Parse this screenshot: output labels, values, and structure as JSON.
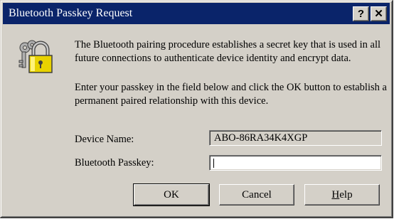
{
  "window": {
    "title": "Bluetooth Passkey Request",
    "help_glyph": "?",
    "close_glyph": "✕"
  },
  "icon": {
    "name": "padlock-keys-icon"
  },
  "message": {
    "paragraph1": "The Bluetooth pairing procedure establishes a secret key that is used in all future connections to authenticate device identity and encrypt data.",
    "paragraph2": "Enter your passkey in the field below and click the OK button to establish a permanent paired relationship with this device."
  },
  "form": {
    "device_name_label": "Device Name:",
    "device_name_value": "ABO-86RA34K4XGP",
    "passkey_label": "Bluetooth Passkey:",
    "passkey_value": ""
  },
  "buttons": {
    "ok": "OK",
    "cancel": "Cancel",
    "help": "Help"
  },
  "colors": {
    "title_bar": "#0a246a",
    "window_face": "#d4d0c8",
    "lock_body": "#e8d200"
  }
}
